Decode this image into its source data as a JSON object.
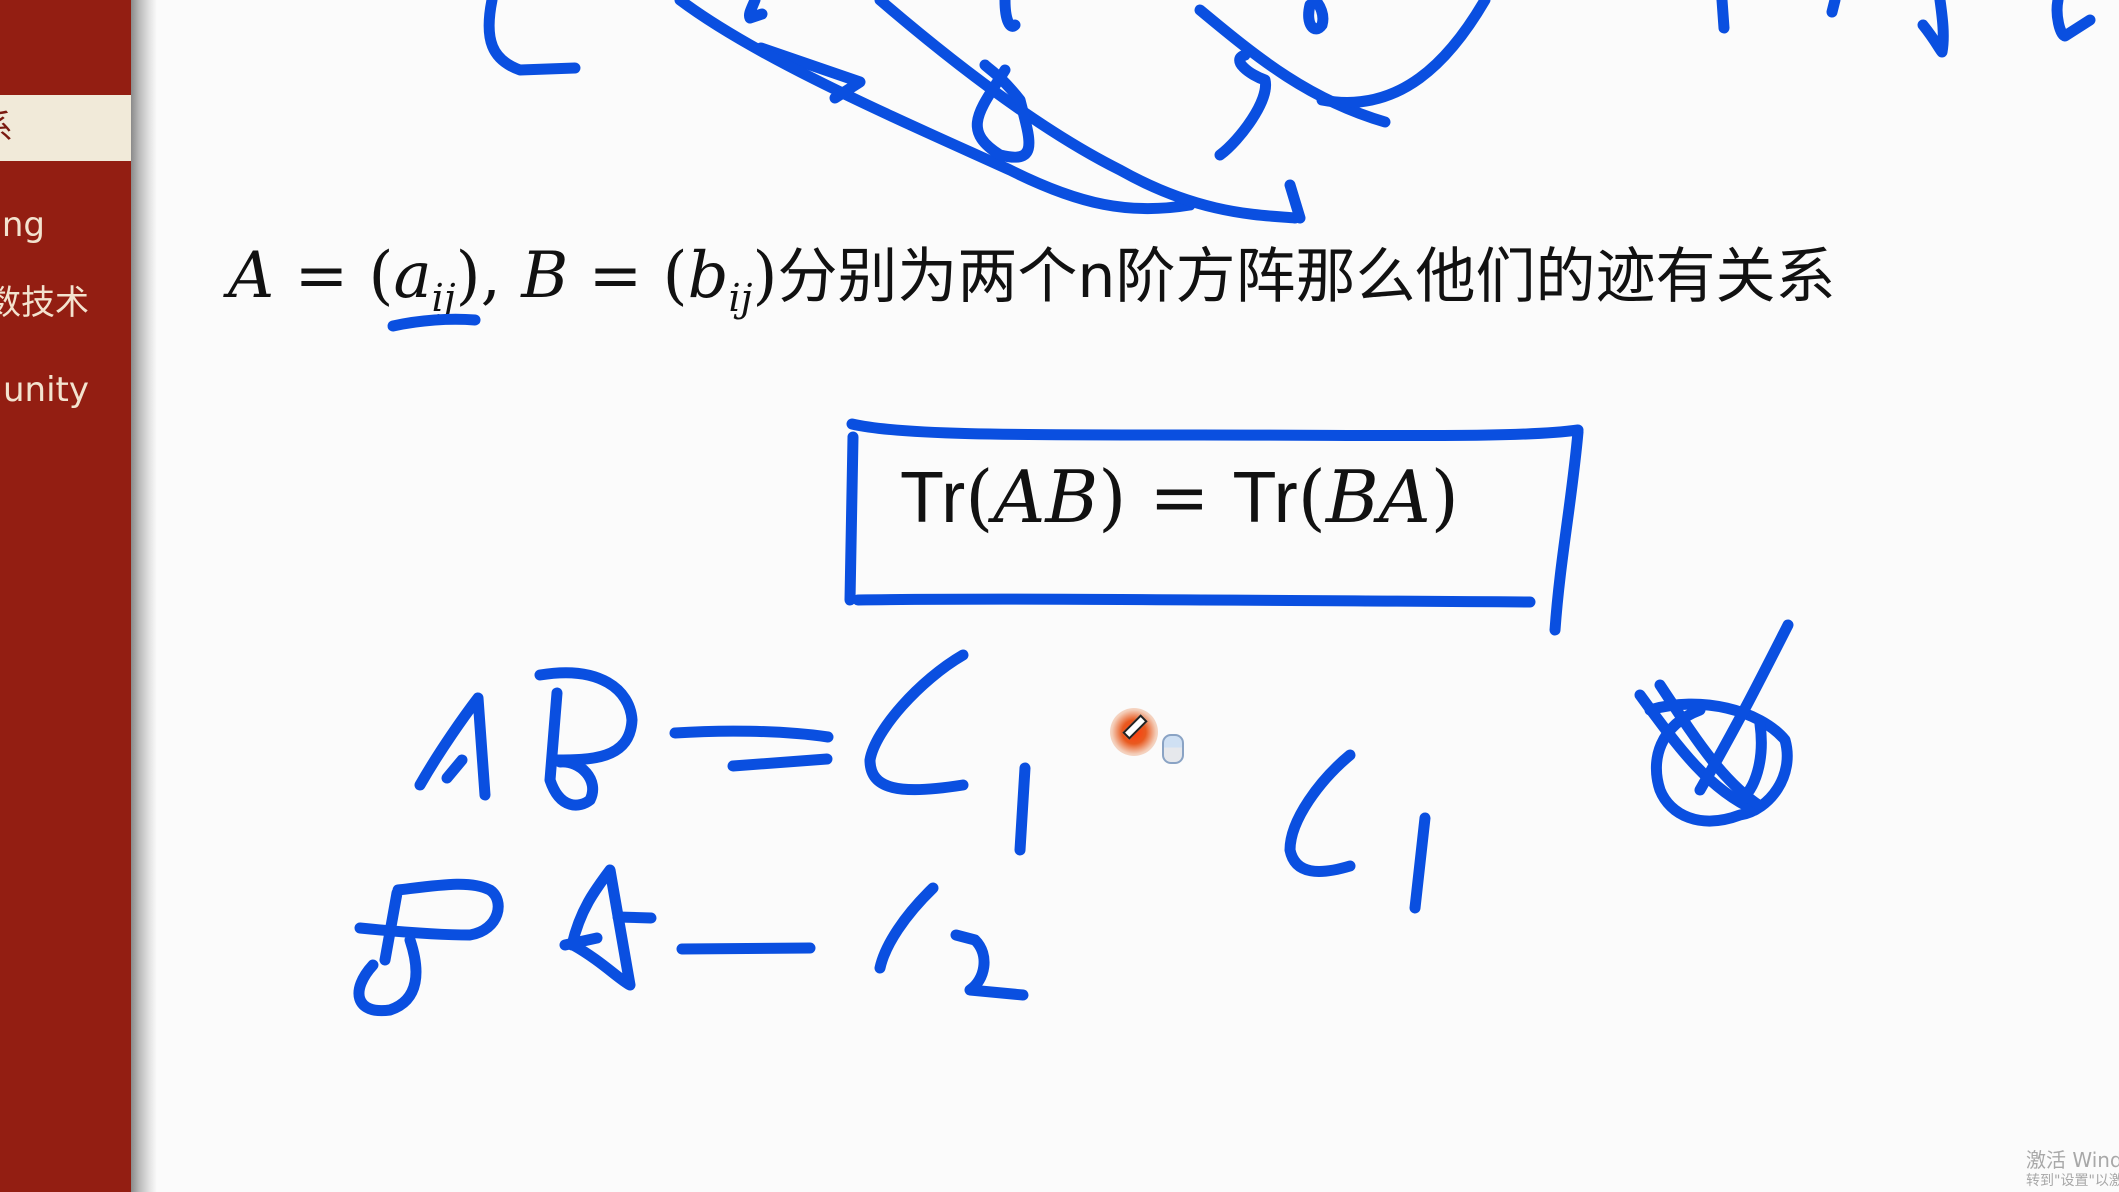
{
  "sidebar": {
    "background_color": "#931e12",
    "active_color": "#f1ead9",
    "items": [
      {
        "label": "系",
        "active": true
      },
      {
        "label": "ng",
        "active": false
      },
      {
        "label": "数技术",
        "active": false
      },
      {
        "label": "unity",
        "active": false
      }
    ]
  },
  "slide": {
    "statement": {
      "A": "A",
      "eq": "=",
      "lparen": "(",
      "a": "a",
      "ij": "ij",
      "rparen": ")",
      "comma": ",",
      "B": "B",
      "b": "b",
      "text": "分别为两个n阶方阵那么他们的迹有关系"
    },
    "formula": {
      "tr": "Tr",
      "lparen": "(",
      "left_args": "AB",
      "rparen": ")",
      "eq": "=",
      "right_args": "BA"
    },
    "handwriting": {
      "ink_color": "#0a4fe0",
      "notes": [
        "AB = C1",
        "BA = C2",
        "C1",
        "crossed-out circle"
      ]
    }
  },
  "watermark": {
    "title": "激活 Windows",
    "subtitle": "转到\"设置\"以激活 Windows。"
  }
}
